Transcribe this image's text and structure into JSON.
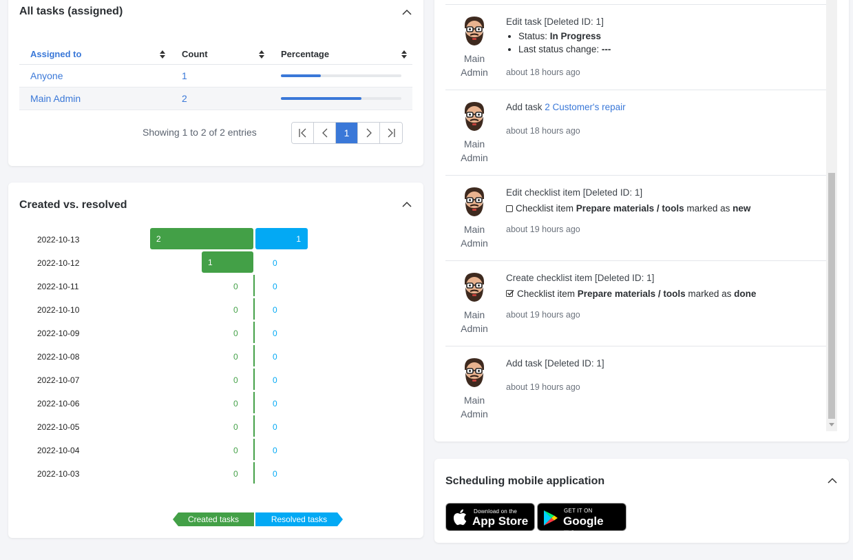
{
  "tasks_card": {
    "title": "All tasks (assigned)",
    "columns": [
      "Assigned to",
      "Count",
      "Percentage"
    ],
    "rows": [
      {
        "assigned_to": "Anyone",
        "count": "1",
        "percent": 33
      },
      {
        "assigned_to": "Main Admin",
        "count": "2",
        "percent": 67
      }
    ],
    "showing": "Showing 1 to 2 of 2 entries",
    "current_page": "1"
  },
  "cvr_card": {
    "title": "Created vs. resolved",
    "legend_created": "Created tasks",
    "legend_resolved": "Resolved tasks",
    "colors": {
      "created": "#43a047",
      "resolved": "#03a9f4"
    }
  },
  "chart_data": {
    "type": "bar",
    "categories": [
      "2022-10-13",
      "2022-10-12",
      "2022-10-11",
      "2022-10-10",
      "2022-10-09",
      "2022-10-08",
      "2022-10-07",
      "2022-10-06",
      "2022-10-05",
      "2022-10-04",
      "2022-10-03"
    ],
    "series": [
      {
        "name": "Created tasks",
        "values": [
          2,
          1,
          0,
          0,
          0,
          0,
          0,
          0,
          0,
          0,
          0
        ]
      },
      {
        "name": "Resolved tasks",
        "values": [
          1,
          0,
          0,
          0,
          0,
          0,
          0,
          0,
          0,
          0,
          0
        ]
      }
    ]
  },
  "activity": {
    "items": [
      {
        "user": [
          "Main",
          "Admin"
        ],
        "title": "Edit task [Deleted ID: 1]",
        "bullets": [
          {
            "label": "Status: ",
            "value": "In Progress"
          },
          {
            "label": "Last status change: ",
            "value": "---"
          }
        ],
        "time": "about 18 hours ago"
      },
      {
        "user": [
          "Main",
          "Admin"
        ],
        "title_prefix": "Add task ",
        "title_link": "2 Customer's repair",
        "time": "about 18 hours ago"
      },
      {
        "user": [
          "Main",
          "Admin"
        ],
        "title": "Edit checklist item [Deleted ID: 1]",
        "detail": {
          "pre": "Checklist item ",
          "item": "Prepare materials / tools",
          "mid": " marked as ",
          "state": "new"
        },
        "time": "about 19 hours ago"
      },
      {
        "user": [
          "Main",
          "Admin"
        ],
        "title": "Create checklist item [Deleted ID: 1]",
        "detail": {
          "pre": "Checklist item ",
          "item": "Prepare materials / tools",
          "mid": " marked as ",
          "state": "done"
        },
        "time": "about 19 hours ago"
      },
      {
        "user": [
          "Main",
          "Admin"
        ],
        "title": "Add task [Deleted ID: 1]",
        "time": "about 19 hours ago"
      }
    ]
  },
  "mobile_card": {
    "title": "Scheduling mobile application",
    "app_store": {
      "small": "Download on the",
      "big": "App Store"
    },
    "google_play": {
      "small": "GET IT ON",
      "big": "Google Play"
    }
  }
}
